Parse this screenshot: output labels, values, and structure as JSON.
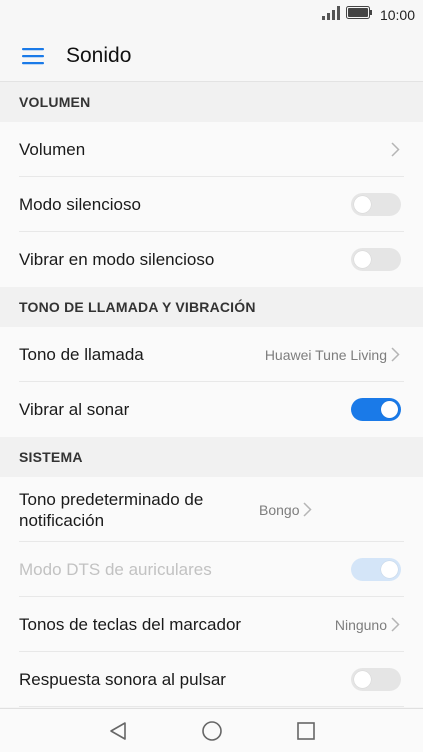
{
  "status_bar": {
    "time": "10:00",
    "signal_icon": "signal-icon",
    "battery_icon": "battery-icon"
  },
  "app_bar": {
    "title": "Sonido",
    "menu_icon": "menu-icon"
  },
  "sections": [
    {
      "header": "VOLUMEN",
      "items": [
        {
          "label": "Volumen",
          "type": "link"
        },
        {
          "label": "Modo silencioso",
          "type": "toggle",
          "on": false
        },
        {
          "label": "Vibrar en modo silencioso",
          "type": "toggle",
          "on": false
        }
      ]
    },
    {
      "header": "TONO DE LLAMADA Y VIBRACIÓN",
      "items": [
        {
          "label": "Tono de llamada",
          "type": "link",
          "value": "Huawei Tune Living"
        },
        {
          "label": "Vibrar al sonar",
          "type": "toggle",
          "on": true
        }
      ]
    },
    {
      "header": "SISTEMA",
      "items": [
        {
          "label": "Tono predeterminado de notificación",
          "type": "link",
          "value": "Bongo"
        },
        {
          "label": "Modo DTS de auriculares",
          "type": "toggle",
          "on": true,
          "disabled": true
        },
        {
          "label": "Tonos de teclas del marcador",
          "type": "link",
          "value": "Ninguno"
        },
        {
          "label": "Respuesta sonora al pulsar",
          "type": "toggle",
          "on": false
        }
      ]
    }
  ],
  "nav_bar": {
    "back_icon": "back-triangle-icon",
    "home_icon": "home-circle-icon",
    "recents_icon": "recents-square-icon"
  },
  "colors": {
    "accent": "#1a7ae8",
    "toggle_off": "#e5e5e5",
    "background": "#f5f5f5"
  }
}
